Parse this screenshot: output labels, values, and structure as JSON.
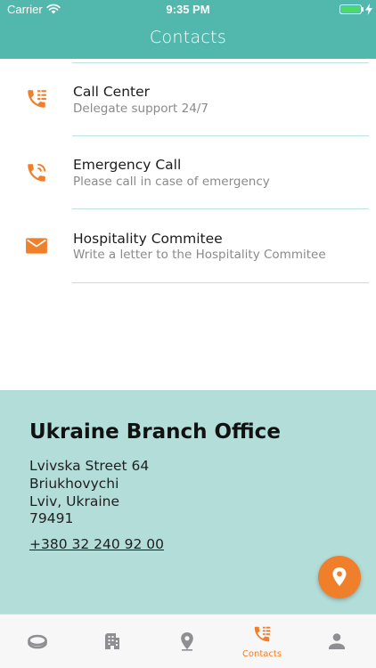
{
  "status_bar": {
    "carrier": "Carrier",
    "time": "9:35 PM",
    "battery_color": "#4cd964"
  },
  "nav": {
    "title": "Contacts"
  },
  "contacts": [
    {
      "icon": "phone-list-icon",
      "title": "Call Center",
      "subtitle": "Delegate support 24/7"
    },
    {
      "icon": "phone-ringing-icon",
      "title": "Emergency Call",
      "subtitle": "Please call in case of emergency"
    },
    {
      "icon": "envelope-icon",
      "title": "Hospitality Commitee",
      "subtitle": "Write a letter to the Hospitality Commitee"
    }
  ],
  "office": {
    "title": "Ukraine Branch Office",
    "address_lines": [
      "Lvivska Street 64",
      "Briukhovychi",
      "Lviv, Ukraine",
      "79491"
    ],
    "phone": "+380 32 240 92 00"
  },
  "tabs": [
    {
      "icon": "ring-icon",
      "label": ""
    },
    {
      "icon": "building-icon",
      "label": ""
    },
    {
      "icon": "location-pin-icon",
      "label": ""
    },
    {
      "icon": "phone-list-icon",
      "label": "Contacts",
      "active": true
    },
    {
      "icon": "person-icon",
      "label": ""
    }
  ],
  "colors": {
    "header": "#52b8ad",
    "accent": "#f07f2c",
    "office_bg": "#b3ddd9",
    "divider": "#bfe3de",
    "tab_inactive": "#8e8e93"
  }
}
